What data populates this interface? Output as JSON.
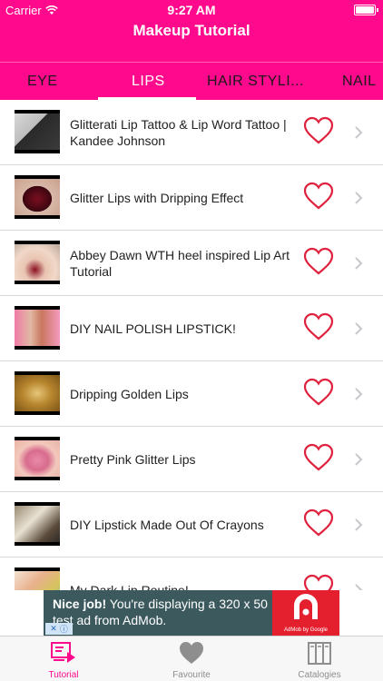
{
  "status_bar": {
    "carrier": "Carrier",
    "time": "9:27 AM"
  },
  "nav": {
    "title": "Makeup Tutorial"
  },
  "tabs": [
    {
      "label": "EYE",
      "active": false
    },
    {
      "label": "LIPS",
      "active": true
    },
    {
      "label": "HAIR STYLI...",
      "active": false
    },
    {
      "label": "NAIL",
      "active": false
    }
  ],
  "videos": [
    {
      "title": "Glitterati Lip Tattoo & Lip Word Tattoo | Kandee Johnson",
      "favorite": false
    },
    {
      "title": "Glitter Lips with Dripping Effect",
      "favorite": false
    },
    {
      "title": "Abbey Dawn WTH heel inspired Lip Art Tutorial",
      "favorite": false
    },
    {
      "title": "DIY NAIL POLISH LIPSTICK!",
      "favorite": false
    },
    {
      "title": "Dripping Golden Lips",
      "favorite": false
    },
    {
      "title": "Pretty Pink Glitter Lips",
      "favorite": false
    },
    {
      "title": "DIY Lipstick Made Out Of Crayons",
      "favorite": false
    },
    {
      "title": "My Dark Lip Routine!",
      "favorite": false
    }
  ],
  "ad": {
    "bold": "Nice job!",
    "text": " You're displaying a 320 x 50 test ad from AdMob.",
    "logo_label": "AdMob by Google"
  },
  "tab_bar": [
    {
      "label": "Tutorial",
      "icon": "tutorial-icon",
      "active": true
    },
    {
      "label": "Favourite",
      "icon": "heart-icon",
      "active": false
    },
    {
      "label": "Catalogies",
      "icon": "catalog-icon",
      "active": false
    }
  ],
  "colors": {
    "brand": "#ff0a8c",
    "heart": "#e0203c",
    "ad_bg": "#3c5a5e"
  }
}
